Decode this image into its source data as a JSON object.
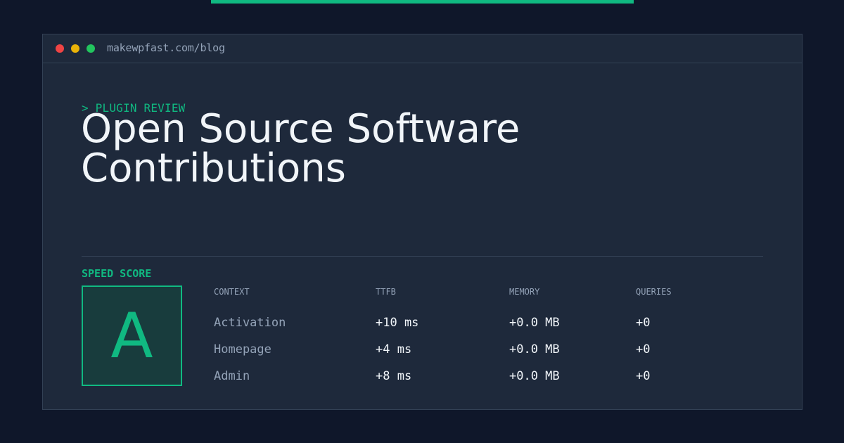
{
  "window": {
    "url": "makewpfast.com/blog"
  },
  "article": {
    "eyebrow": "> PLUGIN REVIEW",
    "title": "Open Source Software Contributions"
  },
  "speed_score": {
    "label": "SPEED SCORE",
    "grade": "A"
  },
  "metrics": {
    "headers": [
      "CONTEXT",
      "TTFB",
      "MEMORY",
      "QUERIES"
    ],
    "rows": [
      {
        "context": "Activation",
        "ttfb": "+10 ms",
        "memory": "+0.0 MB",
        "queries": "+0"
      },
      {
        "context": "Homepage",
        "ttfb": "+4 ms",
        "memory": "+0.0 MB",
        "queries": "+0"
      },
      {
        "context": "Admin",
        "ttfb": "+8 ms",
        "memory": "+0.0 MB",
        "queries": "+0"
      }
    ]
  },
  "colors": {
    "accent": "#10b981",
    "background": "#0f172a",
    "card": "#1e293b",
    "text": "#f1f5f9",
    "muted": "#94a3b8"
  }
}
